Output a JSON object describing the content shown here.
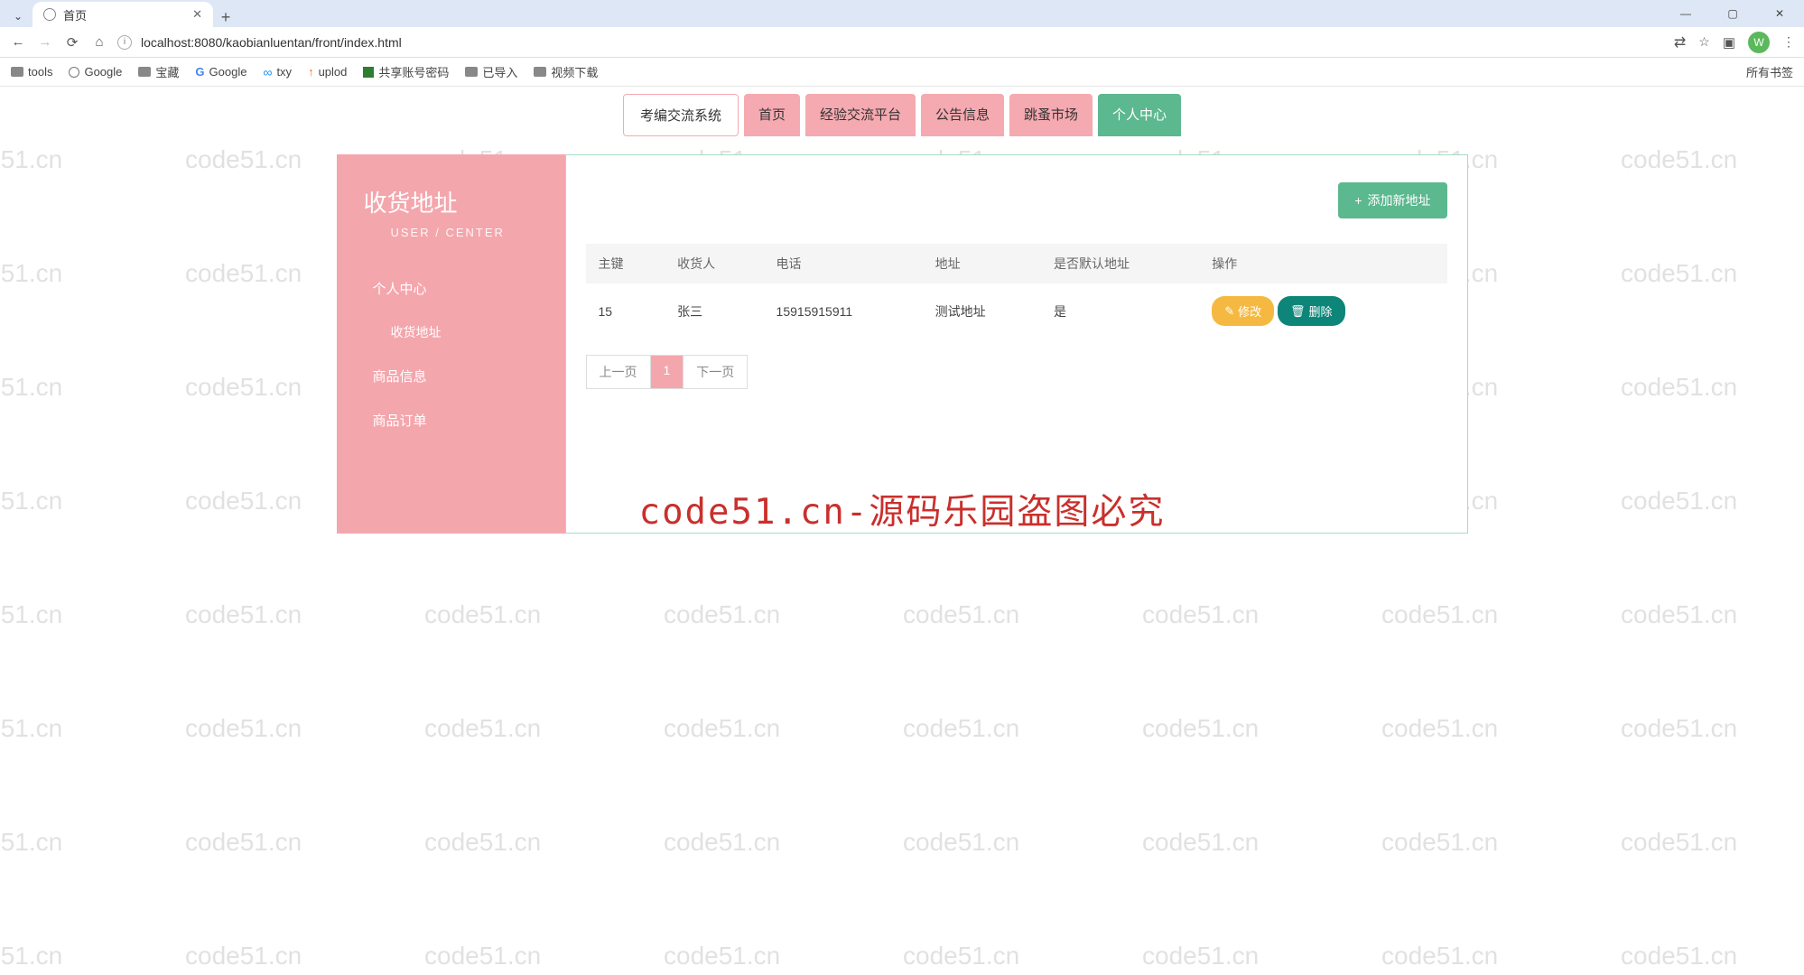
{
  "watermark_text": "code51.cn",
  "browser": {
    "tab_title": "首页",
    "url": "localhost:8080/kaobianluentan/front/index.html",
    "avatar": "W",
    "all_bookmarks": "所有书签"
  },
  "bookmarks": [
    "tools",
    "Google",
    "宝藏",
    "Google",
    "txy",
    "uplod",
    "共享账号密码",
    "已导入",
    "视频下载"
  ],
  "nav": {
    "brand": "考编交流系统",
    "items": [
      "首页",
      "经验交流平台",
      "公告信息",
      "跳蚤市场",
      "个人中心"
    ],
    "active_index": 4
  },
  "sidebar": {
    "title": "收货地址",
    "subtitle": "USER / CENTER",
    "items": [
      "个人中心",
      "收货地址",
      "商品信息",
      "商品订单"
    ]
  },
  "content": {
    "add_button": "添加新地址",
    "columns": [
      "主键",
      "收货人",
      "电话",
      "地址",
      "是否默认地址",
      "操作"
    ],
    "row": {
      "id": "15",
      "name": "张三",
      "phone": "15915915911",
      "address": "测试地址",
      "is_default": "是",
      "edit": "修改",
      "delete": "删除"
    },
    "pagination": {
      "prev": "上一页",
      "current": "1",
      "next": "下一页"
    }
  },
  "big_watermark": "code51.cn-源码乐园盗图必究"
}
